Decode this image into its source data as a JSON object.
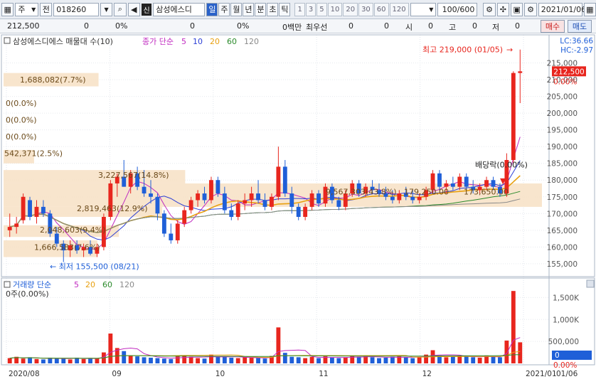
{
  "toolbar": {
    "market_select": "주",
    "prev_label": "전",
    "stock_code": "018260",
    "stock_badge": "신",
    "stock_name": "삼성에스디",
    "periods": [
      "일",
      "주",
      "월",
      "년",
      "분",
      "초",
      "틱"
    ],
    "active_period": "일",
    "intervals": [
      "1",
      "3",
      "5",
      "10",
      "20",
      "30",
      "60",
      "120"
    ],
    "count": "100/600",
    "date": "2021/01/06"
  },
  "infobar": {
    "price": "212,500",
    "v1": "0",
    "p1": "0%",
    "v2": "0",
    "p2": "0%",
    "unit": "0백만",
    "prio_label": "최우선",
    "prio_a": "0",
    "prio_b": "0",
    "open_label": "시",
    "open_v": "0",
    "high_label": "고",
    "high_v": "0",
    "low_label": "저",
    "low_v": "0",
    "buy": "매수",
    "sell": "매도"
  },
  "price_panel": {
    "title": "삼성에스디에스 매물대 수(10)",
    "ma_label": "종가 단순",
    "ma_periods": [
      "5",
      "10",
      "20",
      "60",
      "120"
    ],
    "lc": "LC:36.66",
    "hc": "HC:-2.97",
    "current_price": "212,500",
    "current_pct": "0.00%",
    "high_note": "최고 219,000 (01/05)",
    "low_note": "최저 155,500 (08/21)",
    "dividend_note": "배당락(0.00%)",
    "volume_profile_labels": [
      "1,688,082(7.7%)",
      "0(0.0%)",
      "0(0.0%)",
      "0(0.0%)",
      "542,371(2.5%)",
      "3,227,567(14.8%)",
      "2,819,463(12.9%)",
      "2,048,603(9.4%)",
      "1,666,583(7.6%)",
      "9,567,303(43.8%)",
      "179,250.00",
      "173,650.00"
    ],
    "y_ticks": [
      "215,000",
      "210,000",
      "205,000",
      "200,000",
      "195,000",
      "190,000",
      "185,000",
      "180,000",
      "175,000",
      "170,000",
      "165,000",
      "160,000",
      "155,000"
    ]
  },
  "volume_panel": {
    "title": "거래량 단순",
    "ma_periods": [
      "5",
      "20",
      "60",
      "120"
    ],
    "sub_label": "0주(0.00%)",
    "y_ticks": [
      "1,500K",
      "1,000K",
      "500,000"
    ],
    "current_value": "0",
    "current_pct": "0.00%"
  },
  "x_axis": [
    "2020/08",
    "09",
    "10",
    "11",
    "12",
    "2021/01",
    "01/06"
  ],
  "colors": {
    "up": "#e8261e",
    "down": "#1f5fd8",
    "ma5": "#c02bc0",
    "ma10": "#2c3fd6",
    "ma20": "#e8a010",
    "ma60": "#2a8a2a",
    "ma120": "#8a8a8a",
    "profile": "#f7e0c4"
  },
  "chart_data": {
    "type": "candlestick",
    "ohlc": [
      [
        165000,
        170000,
        163000,
        166000
      ],
      [
        166000,
        169000,
        164000,
        167000
      ],
      [
        168000,
        176000,
        167000,
        175000
      ],
      [
        174000,
        175000,
        168000,
        169000
      ],
      [
        169000,
        174000,
        167000,
        172000
      ],
      [
        172000,
        174000,
        169000,
        170000
      ],
      [
        170000,
        171000,
        163000,
        164000
      ],
      [
        164000,
        166000,
        160000,
        161000
      ],
      [
        161000,
        162000,
        155500,
        159000
      ],
      [
        159000,
        162000,
        157000,
        160500
      ],
      [
        160500,
        162000,
        158000,
        159000
      ],
      [
        159000,
        161000,
        157000,
        160000
      ],
      [
        160000,
        162000,
        157500,
        158000
      ],
      [
        158000,
        161000,
        157000,
        160000
      ],
      [
        160000,
        170000,
        159000,
        169000
      ],
      [
        169000,
        180000,
        168000,
        179000
      ],
      [
        179000,
        182000,
        175000,
        181000
      ],
      [
        181000,
        186000,
        178000,
        178000
      ],
      [
        178000,
        183000,
        176000,
        182000
      ],
      [
        182000,
        184000,
        177000,
        178000
      ],
      [
        178000,
        183000,
        175000,
        176000
      ],
      [
        176000,
        180000,
        173000,
        175000
      ],
      [
        175000,
        176000,
        168000,
        170000
      ],
      [
        170000,
        171000,
        163000,
        164000
      ],
      [
        164000,
        167000,
        161000,
        162000
      ],
      [
        162000,
        168000,
        161000,
        167000
      ],
      [
        167000,
        172000,
        166000,
        171000
      ],
      [
        171000,
        175000,
        170000,
        174000
      ],
      [
        174000,
        177000,
        172000,
        176000
      ],
      [
        176000,
        178000,
        173000,
        174000
      ],
      [
        174000,
        181000,
        173000,
        180000
      ],
      [
        180000,
        181000,
        175000,
        176000
      ],
      [
        176000,
        178000,
        170000,
        171000
      ],
      [
        171000,
        173000,
        168000,
        169000
      ],
      [
        169000,
        174000,
        168000,
        173000
      ],
      [
        173000,
        176000,
        171000,
        174000
      ],
      [
        174000,
        178000,
        172000,
        176000
      ],
      [
        176000,
        180000,
        173000,
        174000
      ],
      [
        174000,
        176000,
        171000,
        172000
      ],
      [
        172000,
        176000,
        171000,
        175000
      ],
      [
        175000,
        190000,
        174000,
        184000
      ],
      [
        184000,
        186000,
        175000,
        176000
      ],
      [
        176000,
        178000,
        170000,
        172000
      ],
      [
        172000,
        173000,
        168000,
        169000
      ],
      [
        169000,
        173000,
        168000,
        172000
      ],
      [
        172000,
        177000,
        171000,
        176000
      ],
      [
        176000,
        177000,
        172000,
        173000
      ],
      [
        173000,
        179000,
        172000,
        178000
      ],
      [
        178000,
        179000,
        173000,
        174000
      ],
      [
        174000,
        175000,
        171000,
        172000
      ],
      [
        172000,
        177000,
        171000,
        176000
      ],
      [
        176000,
        180000,
        175000,
        179000
      ],
      [
        179000,
        180000,
        175000,
        176000
      ],
      [
        176000,
        179000,
        175000,
        178000
      ],
      [
        178000,
        180000,
        176000,
        177000
      ],
      [
        177000,
        179000,
        175000,
        176000
      ],
      [
        176000,
        178000,
        174000,
        175000
      ],
      [
        175000,
        177000,
        173000,
        174000
      ],
      [
        174000,
        177000,
        173000,
        176000
      ],
      [
        176000,
        178000,
        174000,
        175000
      ],
      [
        175000,
        177000,
        173000,
        174000
      ],
      [
        174000,
        176000,
        173000,
        175000
      ],
      [
        175000,
        178000,
        174000,
        177000
      ],
      [
        177000,
        183000,
        176000,
        182000
      ],
      [
        182000,
        183000,
        177000,
        178000
      ],
      [
        178000,
        180000,
        176000,
        179000
      ],
      [
        179000,
        181000,
        177000,
        178000
      ],
      [
        178000,
        182000,
        177000,
        181000
      ],
      [
        181000,
        182000,
        177000,
        178000
      ],
      [
        178000,
        180000,
        176000,
        177000
      ],
      [
        177000,
        179000,
        176000,
        178000
      ],
      [
        178000,
        181000,
        177000,
        180000
      ],
      [
        180000,
        181000,
        177000,
        178000
      ],
      [
        178000,
        179000,
        175000,
        176000
      ],
      [
        176000,
        188000,
        175000,
        186000
      ],
      [
        186000,
        212500,
        185000,
        212000
      ],
      [
        212000,
        219000,
        203000,
        212500
      ]
    ],
    "volume_max_k": 1750,
    "volume": [
      120,
      150,
      110,
      140,
      100,
      90,
      130,
      110,
      120,
      90,
      130,
      100,
      120,
      110,
      250,
      680,
      350,
      280,
      180,
      160,
      140,
      130,
      120,
      110,
      100,
      160,
      180,
      150,
      120,
      110,
      200,
      160,
      150,
      130,
      120,
      140,
      130,
      120,
      110,
      170,
      820,
      240,
      150,
      140,
      120,
      150,
      120,
      160,
      130,
      120,
      140,
      170,
      150,
      160,
      140,
      120,
      130,
      150,
      160,
      140,
      120,
      150,
      200,
      300,
      180,
      140,
      150,
      170,
      160,
      140,
      130,
      180,
      150,
      140,
      520,
      1650,
      480
    ],
    "volume_profile": [
      {
        "lo": 208000,
        "hi": 212000,
        "value": 1688082,
        "pct": 7.7
      },
      {
        "lo": 185000,
        "hi": 189000,
        "value": 542371,
        "pct": 2.5
      },
      {
        "lo": 179000,
        "hi": 183000,
        "value": 3227567,
        "pct": 14.8
      },
      {
        "lo": 172000,
        "hi": 179000,
        "value": 9567303,
        "pct": 43.8
      },
      {
        "lo": 169000,
        "hi": 172000,
        "value": 2819463,
        "pct": 12.9
      },
      {
        "lo": 163000,
        "hi": 166500,
        "value": 2048603,
        "pct": 9.4
      },
      {
        "lo": 157000,
        "hi": 162000,
        "value": 1666583,
        "pct": 7.6
      }
    ],
    "ylim": [
      152000,
      220000
    ]
  }
}
